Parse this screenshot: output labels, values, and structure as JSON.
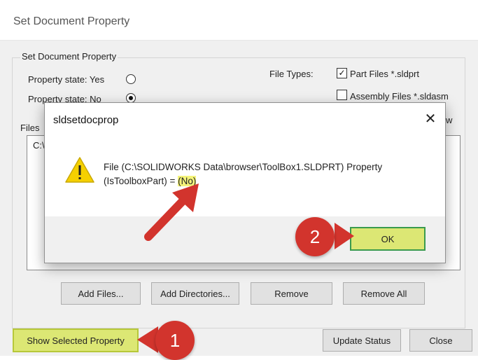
{
  "window": {
    "title": "Set Document Property"
  },
  "group": {
    "label": "Set Document Property"
  },
  "options": {
    "state_yes": "Property state: Yes",
    "state_no": "Property state: No",
    "file_types_label": "File Types:",
    "part_files": "Part Files *.sldprt",
    "assembly_files": "Assembly Files *.sldasm",
    "extra_fragment": "w"
  },
  "files": {
    "label": "Files",
    "first_item": "C:\\"
  },
  "buttons": {
    "add_files": "Add Files...",
    "add_directories": "Add Directories...",
    "remove": "Remove",
    "remove_all": "Remove All",
    "show_selected": "Show Selected Property",
    "update_status": "Update Status",
    "close": "Close"
  },
  "dialog": {
    "title": "sldsetdocprop",
    "message_line1": "File (C:\\SOLIDWORKS Data\\browser\\ToolBox1.SLDPRT) Property",
    "message_line2_prefix": "(IsToolboxPart) = ",
    "message_value": "(No)",
    "ok": "OK",
    "close_glyph": "✕"
  },
  "annotations": {
    "marker1": "1",
    "marker2": "2"
  },
  "colors": {
    "highlight": "#dce774",
    "marker": "#d2342d",
    "arrow": "#d2342d"
  }
}
